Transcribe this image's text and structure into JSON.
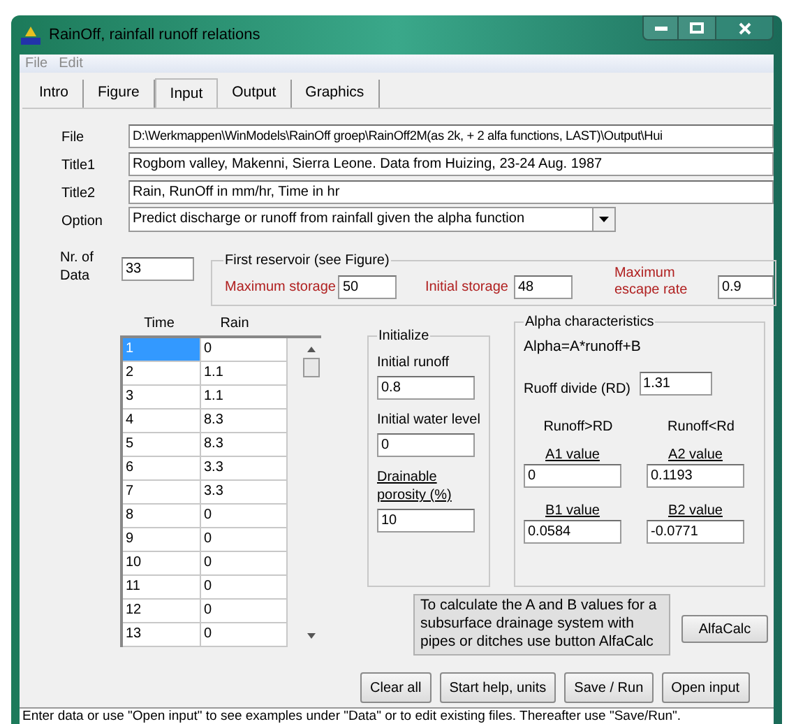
{
  "window": {
    "title": "RainOff, rainfall runoff relations"
  },
  "menu": [
    {
      "label": "File",
      "disabled": true
    },
    {
      "label": "Edit",
      "disabled": true
    }
  ],
  "tabs": [
    {
      "label": "Intro",
      "selected": false
    },
    {
      "label": "Figure",
      "selected": false
    },
    {
      "label": "Input",
      "selected": true
    },
    {
      "label": "Output",
      "selected": false
    },
    {
      "label": "Graphics",
      "selected": false
    }
  ],
  "fields": [
    {
      "label": "File",
      "value": "D:\\Werkmappen\\WinModels\\RainOff groep\\RainOff2M(as 2k, + 2 alfa functions, LAST)\\Output\\Hui"
    },
    {
      "label": "Title1",
      "value": "Rogbom valley, Makenni, Sierra Leone. Data from Huizing, 23-24 Aug. 1987"
    },
    {
      "label": "Title2",
      "value": "Rain, RunOff in mm/hr, Time in hr"
    }
  ],
  "option": {
    "label": "Option",
    "value": "Predict discharge or runoff from rainfall given the alpha function"
  },
  "nr_of_data": {
    "label": "Nr. of Data",
    "value": "33"
  },
  "first_reservoir": {
    "title": "First reservoir (see Figure)",
    "fields": [
      {
        "label": "Maximum storage",
        "value": "50"
      },
      {
        "label": "Initial storage",
        "value": "48"
      },
      {
        "label": "Maximum escape rate",
        "value": "0.9"
      }
    ]
  },
  "table": {
    "columns": [
      "Time",
      "Rain"
    ],
    "rows": [
      {
        "cells": [
          "1",
          "0"
        ],
        "selected": true
      },
      {
        "cells": [
          "2",
          "1.1"
        ],
        "selected": false
      },
      {
        "cells": [
          "3",
          "1.1"
        ],
        "selected": false
      },
      {
        "cells": [
          "4",
          "8.3"
        ],
        "selected": false
      },
      {
        "cells": [
          "5",
          "8.3"
        ],
        "selected": false
      },
      {
        "cells": [
          "6",
          "3.3"
        ],
        "selected": false
      },
      {
        "cells": [
          "7",
          "3.3"
        ],
        "selected": false
      },
      {
        "cells": [
          "8",
          "0"
        ],
        "selected": false
      },
      {
        "cells": [
          "9",
          "0"
        ],
        "selected": false
      },
      {
        "cells": [
          "10",
          "0"
        ],
        "selected": false
      },
      {
        "cells": [
          "11",
          "0"
        ],
        "selected": false
      },
      {
        "cells": [
          "12",
          "0"
        ],
        "selected": false
      },
      {
        "cells": [
          "13",
          "0"
        ],
        "selected": false
      }
    ]
  },
  "initialize": {
    "title": "Initialize",
    "fields": [
      {
        "label": "Initial runoff",
        "value": "0.8"
      },
      {
        "label": "Initial water level",
        "value": "0"
      },
      {
        "label": "Drainable porosity (%)",
        "value": "10"
      }
    ]
  },
  "alpha": {
    "title": "Alpha characteristics",
    "formula": "Alpha=A*runoff+B",
    "divide": {
      "label": "Ruoff divide (RD)",
      "value": "1.31"
    },
    "headings": [
      "Runoff>RD",
      "Runoff<Rd"
    ],
    "values": [
      {
        "label": "A1 value",
        "value": "0"
      },
      {
        "label": "A2 value",
        "value": "0.1193"
      },
      {
        "label": "B1 value",
        "value": "0.0584"
      },
      {
        "label": "B2 value",
        "value": "-0.0771"
      }
    ]
  },
  "info": "To calculate the A and B values for a subsurface drainage system with pipes or ditches use button AlfaCalc",
  "alfacalc_button": "AlfaCalc",
  "buttons": [
    "Clear all",
    "Start help, units",
    "Save / Run",
    "Open input"
  ],
  "status_bar": "Enter data or use \"Open input\" to see examples under \"Data\" or to edit existing files. Thereafter use \"Save/Run\"."
}
